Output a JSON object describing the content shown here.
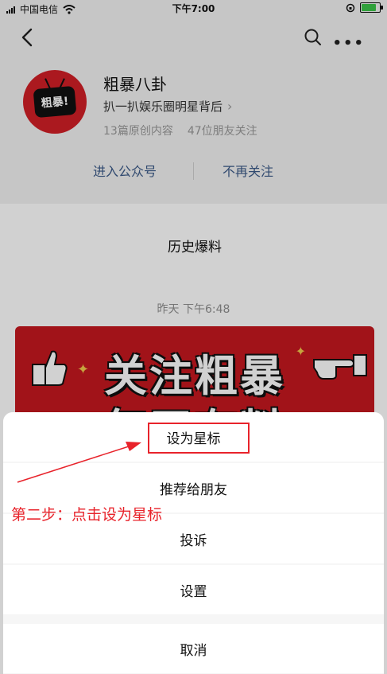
{
  "status_bar": {
    "carrier": "中国电信",
    "time": "下午7:00"
  },
  "navbar": {
    "back_icon": "chevron-left-icon",
    "search_icon": "search-icon",
    "more_icon": "more-dots-icon"
  },
  "profile": {
    "avatar_text": "粗暴!",
    "name": "粗暴八卦",
    "description": "扒一扒娱乐圈明星背后",
    "original_count": "13篇原创内容",
    "friends_following": "47位朋友关注",
    "enter_label": "进入公众号",
    "unfollow_label": "不再关注"
  },
  "history_button": "历史爆料",
  "timestamp": "昨天 下午6:48",
  "banner": {
    "line1": "关注粗暴",
    "line2": "每天有料"
  },
  "action_sheet": {
    "items": [
      "设为星标",
      "推荐给朋友",
      "投诉",
      "设置"
    ],
    "cancel": "取消"
  },
  "annotation": {
    "text": "第二步：点击设为星标",
    "color": "#e8232b"
  }
}
